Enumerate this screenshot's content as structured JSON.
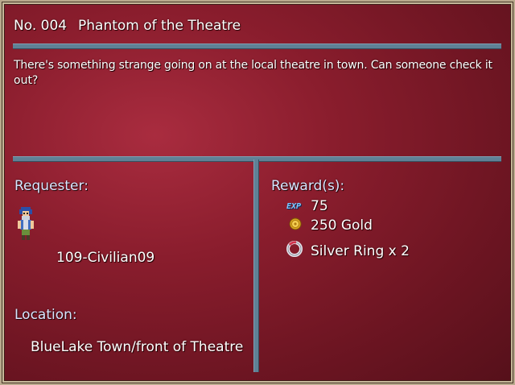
{
  "quest": {
    "number": "No. 004",
    "title": "Phantom of the Theatre",
    "description_line1": "There's something strange going on at the local theatre in town. Can someone check it",
    "description_line2": "out?"
  },
  "requester": {
    "heading": "Requester:",
    "name": "109-Civilian09"
  },
  "location": {
    "heading": "Location:",
    "value": "BlueLake Town/front of Theatre"
  },
  "rewards": {
    "heading": "Reward(s):",
    "exp_label": "EXP",
    "exp_value": "75",
    "gold": "250 Gold",
    "item": "Silver Ring x 2"
  },
  "colors": {
    "panel_red": "#8a1d2d",
    "separator_blue": "#5f8196",
    "heading_text": "#d8e6ff"
  },
  "icons": [
    "civilian-sprite-icon",
    "exp-icon",
    "gold-coin-icon",
    "silver-ring-icon"
  ]
}
